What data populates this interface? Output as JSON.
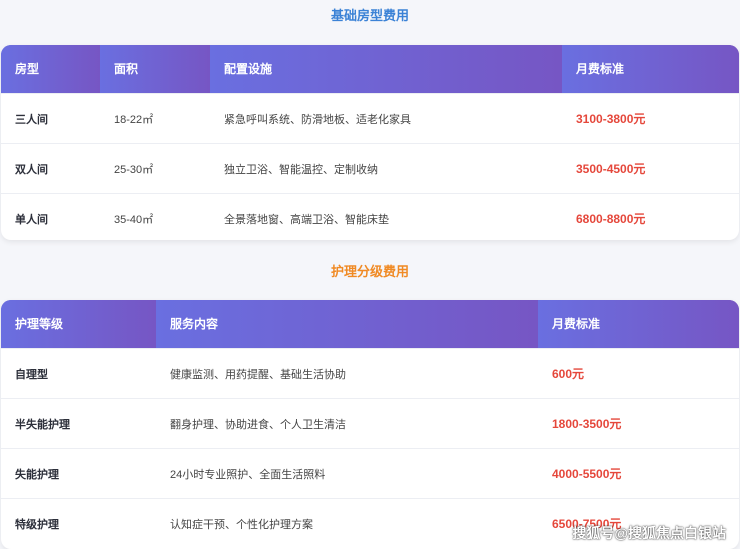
{
  "room_section": {
    "title": "基础房型费用",
    "headers": [
      "房型",
      "面积",
      "配置设施",
      "月费标准"
    ],
    "rows": [
      {
        "type": "三人间",
        "area": "18-22㎡",
        "facilities": "紧急呼叫系统、防滑地板、适老化家具",
        "price": "3100-3800元"
      },
      {
        "type": "双人间",
        "area": "25-30㎡",
        "facilities": "独立卫浴、智能温控、定制收纳",
        "price": "3500-4500元"
      },
      {
        "type": "单人间",
        "area": "35-40㎡",
        "facilities": "全景落地窗、高端卫浴、智能床垫",
        "price": "6800-8800元"
      }
    ]
  },
  "care_section": {
    "title": "护理分级费用",
    "headers": [
      "护理等级",
      "服务内容",
      "月费标准"
    ],
    "rows": [
      {
        "level": "自理型",
        "service": "健康监测、用药提醒、基础生活协助",
        "price": "600元"
      },
      {
        "level": "半失能护理",
        "service": "翻身护理、协助进食、个人卫生清洁",
        "price": "1800-3500元"
      },
      {
        "level": "失能护理",
        "service": "24小时专业照护、全面生活照料",
        "price": "4000-5500元"
      },
      {
        "level": "特级护理",
        "service": "认知症干预、个性化护理方案",
        "price": "6500-7500元"
      }
    ]
  },
  "watermark": "搜狐号@搜狐焦点白银站",
  "colors": {
    "section1_title": "#3b82d6",
    "section2_title": "#f08a24",
    "price": "#e5473b",
    "header_start": "#6a6fe0",
    "header_end": "#7d4fb0"
  }
}
